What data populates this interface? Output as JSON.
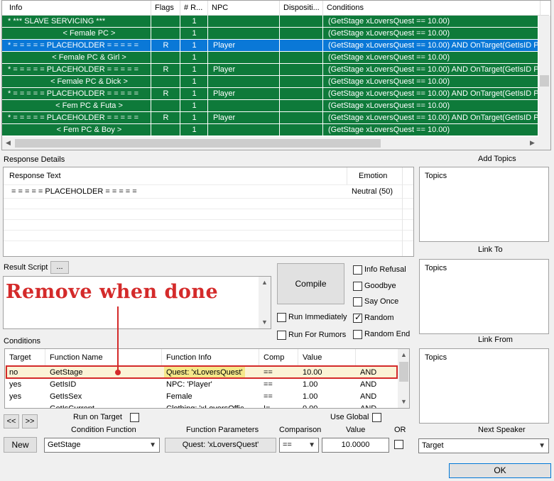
{
  "info_table": {
    "columns": [
      "Info",
      "Flags",
      "# R...",
      "NPC",
      "Dispositi...",
      "Conditions"
    ],
    "rows": [
      {
        "info": "* *** SLAVE SERVICING ***",
        "flags": "",
        "r": "1",
        "npc": "",
        "conditions": "(GetStage xLoversQuest == 10.00)",
        "selected": false,
        "align": "left"
      },
      {
        "info": "< Female PC >",
        "flags": "",
        "r": "1",
        "npc": "",
        "conditions": "(GetStage xLoversQuest == 10.00)",
        "selected": false,
        "align": "center"
      },
      {
        "info": "* = = = = = PLACEHOLDER = = = = =",
        "flags": "R",
        "r": "1",
        "npc": "Player",
        "conditions": "(GetStage xLoversQuest == 10.00) AND OnTarget(GetIsID Pla",
        "selected": true,
        "align": "left"
      },
      {
        "info": "< Female PC & Girl >",
        "flags": "",
        "r": "1",
        "npc": "",
        "conditions": "(GetStage xLoversQuest == 10.00)",
        "selected": false,
        "align": "center"
      },
      {
        "info": "* = = = = = PLACEHOLDER = = = = =",
        "flags": "R",
        "r": "1",
        "npc": "Player",
        "conditions": "(GetStage xLoversQuest == 10.00) AND OnTarget(GetIsID Pla",
        "selected": false,
        "align": "left"
      },
      {
        "info": "< Female PC & Dick >",
        "flags": "",
        "r": "1",
        "npc": "",
        "conditions": "(GetStage xLoversQuest == 10.00)",
        "selected": false,
        "align": "center"
      },
      {
        "info": "* = = = = = PLACEHOLDER = = = = =",
        "flags": "R",
        "r": "1",
        "npc": "Player",
        "conditions": "(GetStage xLoversQuest == 10.00) AND OnTarget(GetIsID Pla",
        "selected": false,
        "align": "left"
      },
      {
        "info": "< Fem PC & Futa >",
        "flags": "",
        "r": "1",
        "npc": "",
        "conditions": "(GetStage xLoversQuest == 10.00)",
        "selected": false,
        "align": "center"
      },
      {
        "info": "* = = = = = PLACEHOLDER = = = = =",
        "flags": "R",
        "r": "1",
        "npc": "Player",
        "conditions": "(GetStage xLoversQuest == 10.00) AND OnTarget(GetIsID Pla",
        "selected": false,
        "align": "left"
      },
      {
        "info": "< Fem PC & Boy >",
        "flags": "",
        "r": "1",
        "npc": "",
        "conditions": "(GetStage xLoversQuest == 10.00)",
        "selected": false,
        "align": "center"
      }
    ]
  },
  "response_details": {
    "label": "Response Details",
    "col_text": "Response Text",
    "col_emotion": "Emotion",
    "rows": [
      {
        "text": "= = = = = PLACEHOLDER = = = = =",
        "emotion": "Neutral (50)"
      }
    ]
  },
  "add_topics": {
    "label": "Add Topics",
    "header": "Topics"
  },
  "link_to": {
    "label": "Link To",
    "header": "Topics"
  },
  "link_from": {
    "label": "Link From",
    "header": "Topics"
  },
  "result_script": {
    "label": "Result Script",
    "button": "..."
  },
  "compile_button": "Compile",
  "checkboxes": {
    "info_refusal": {
      "label": "Info Refusal",
      "checked": false
    },
    "goodbye": {
      "label": "Goodbye",
      "checked": false
    },
    "say_once": {
      "label": "Say Once",
      "checked": false
    },
    "random": {
      "label": "Random",
      "checked": true
    },
    "random_end": {
      "label": "Random End",
      "checked": false
    },
    "run_immediately": {
      "label": "Run Immediately",
      "checked": false
    },
    "run_for_rumors": {
      "label": "Run For Rumors",
      "checked": false
    }
  },
  "conditions": {
    "label": "Conditions",
    "columns": [
      "Target",
      "Function Name",
      "Function Info",
      "Comp",
      "Value",
      ""
    ],
    "rows": [
      {
        "target": "no",
        "fn": "GetStage",
        "info": "Quest: 'xLoversQuest'",
        "comp": "==",
        "value": "10.00",
        "op": "AND",
        "highlight": true
      },
      {
        "target": "yes",
        "fn": "GetIsID",
        "info": "NPC: 'Player'",
        "comp": "==",
        "value": "1.00",
        "op": "AND",
        "highlight": false
      },
      {
        "target": "yes",
        "fn": "GetIsSex",
        "info": "Female",
        "comp": "==",
        "value": "1.00",
        "op": "AND",
        "highlight": false
      },
      {
        "target": "",
        "fn": "GetIsCurrent...",
        "info": "Clothing: 'xLoversOffic...",
        "comp": "!=",
        "value": "0.00",
        "op": "AND",
        "highlight": false
      }
    ]
  },
  "annotation": {
    "text": "Remove when done",
    "color": "#d42a2a"
  },
  "nav": {
    "prev": "<<",
    "next": ">>"
  },
  "editor": {
    "run_on_target_label": "Run on Target",
    "use_global_label": "Use Global",
    "condition_function_label": "Condition Function",
    "function_parameters_label": "Function Parameters",
    "comparison_label": "Comparison",
    "value_label": "Value",
    "or_label": "OR",
    "new_button": "New",
    "condition_function_value": "GetStage",
    "function_parameters_value": "Quest: 'xLoversQuest'",
    "comparison_value": "==",
    "value_value": "10.0000"
  },
  "next_speaker": {
    "label": "Next Speaker",
    "value": "Target"
  },
  "ok_button": "OK",
  "colors": {
    "row_green": "#0e7a3a",
    "row_selected": "#0a78d7",
    "highlight_yellow": "#f5e88a",
    "annotation_red": "#d42a2a"
  }
}
